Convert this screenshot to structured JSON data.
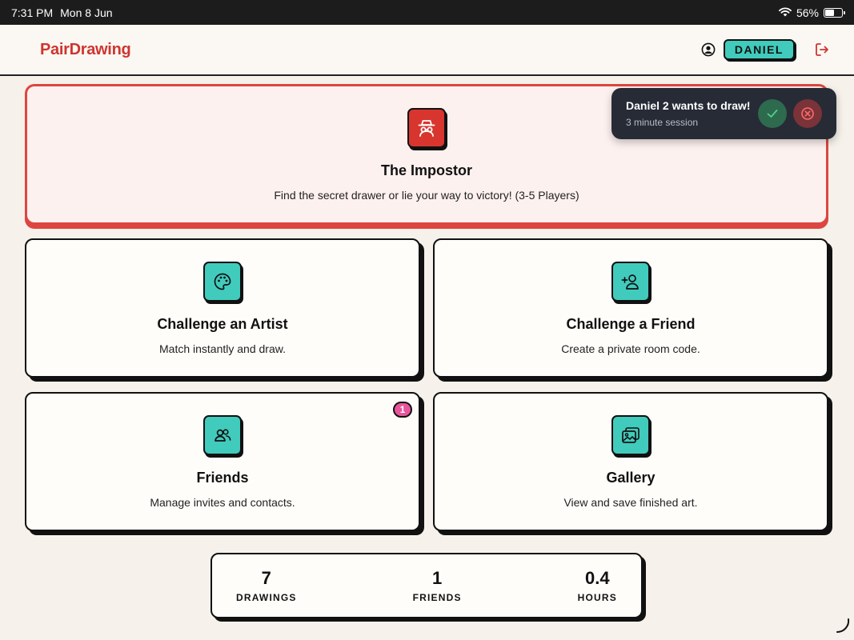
{
  "status_bar": {
    "time": "7:31 PM",
    "date": "Mon 8 Jun",
    "battery": "56%",
    "battery_level": 0.56
  },
  "header": {
    "logo": "PairDrawing",
    "user_name": "DANIEL"
  },
  "notification": {
    "title": "Daniel 2 wants to draw!",
    "subtitle": "3 minute session"
  },
  "cards": {
    "impostor": {
      "title": "The Impostor",
      "desc": "Find the secret drawer or lie your way to victory! (3-5 Players)",
      "icon": "spy-icon"
    },
    "artist": {
      "title": "Challenge an Artist",
      "desc": "Match instantly and draw.",
      "icon": "palette-icon"
    },
    "friend": {
      "title": "Challenge a Friend",
      "desc": "Create a private room code.",
      "icon": "add-user-icon"
    },
    "friends": {
      "title": "Friends",
      "desc": "Manage invites and contacts.",
      "icon": "users-icon",
      "badge": "1"
    },
    "gallery": {
      "title": "Gallery",
      "desc": "View and save finished art.",
      "icon": "gallery-icon"
    }
  },
  "stats": [
    {
      "value": "7",
      "label": "DRAWINGS"
    },
    {
      "value": "1",
      "label": "FRIENDS"
    },
    {
      "value": "0.4",
      "label": "HOURS"
    }
  ],
  "colors": {
    "accent": "#41cbbc",
    "brand": "#cf3530",
    "impostor_border": "#dd4640",
    "badge": "#e8559a",
    "toast_bg": "#262b36"
  }
}
